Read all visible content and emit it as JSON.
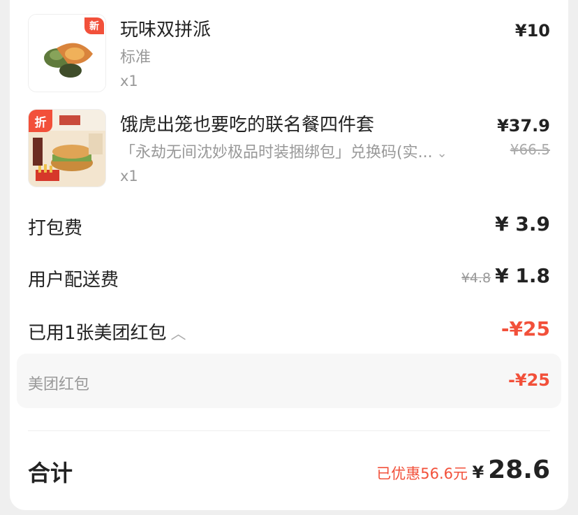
{
  "items": [
    {
      "name": "玩味双拼派",
      "spec": "标准",
      "qty": "x1",
      "price": "¥10",
      "badge": "新"
    },
    {
      "name": "饿虎出笼也要吃的联名餐四件套",
      "spec": "「永劫无间沈妙极品时装捆绑包」兑换码(实...",
      "qty": "x1",
      "price": "¥37.9",
      "old_price": "¥66.5",
      "badge": "折"
    }
  ],
  "fees": {
    "packing_label": "打包费",
    "packing_value": "¥ 3.9",
    "delivery_label": "用户配送费",
    "delivery_old": "¥4.8",
    "delivery_value": "¥ 1.8",
    "redpacket_label": "已用1张美团红包",
    "redpacket_value": "-¥25",
    "sub_label": "美团红包",
    "sub_value": "-¥25"
  },
  "total": {
    "label": "合计",
    "saved": "已优惠56.6元",
    "currency": "¥",
    "amount": "28.6"
  },
  "colors": {
    "accent": "#f2503a",
    "muted": "#999999"
  },
  "icons": [
    "chevron-down-icon",
    "chevron-up-icon"
  ]
}
